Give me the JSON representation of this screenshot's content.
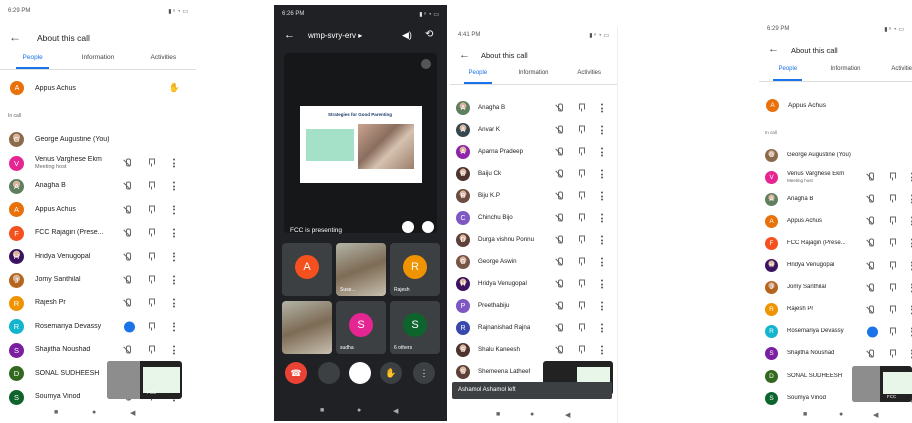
{
  "p1": {
    "status": "6:29 PM",
    "status_r": "▮ ⁿ ◔ ▭",
    "title": "About this call",
    "tabs": [
      "People",
      "Information",
      "Activities"
    ],
    "host": {
      "name": "Appus Achus",
      "letter": "A",
      "color": "#e8710a"
    },
    "section": "In call",
    "rows": [
      {
        "n": "George Augustine (You)",
        "l": "G",
        "c": "#8b6b4a",
        "img": true
      },
      {
        "n": "Venus Varghese Ekm",
        "s": "Meeting host",
        "l": "V",
        "c": "#e52592"
      },
      {
        "n": "Anagha B",
        "l": "A",
        "c": "#5f7f5f",
        "img": true
      },
      {
        "n": "Appus Achus",
        "l": "A",
        "c": "#e8710a"
      },
      {
        "n": "FCC Rajagiri (Prese...",
        "l": "F",
        "c": "#f4511e",
        "blue": true
      },
      {
        "n": "Hridya Venugopal",
        "l": "H",
        "c": "#3c1361",
        "img": true
      },
      {
        "n": "Jomy Santhilal",
        "l": "J",
        "c": "#b5651d",
        "img": true
      },
      {
        "n": "Rajesh Pr",
        "l": "R",
        "c": "#f09300"
      },
      {
        "n": "Rosemariya Devassy",
        "l": "R",
        "c": "#12b5cb",
        "talk": true
      },
      {
        "n": "Shajitha Noushad",
        "l": "S",
        "c": "#7b1fa2"
      },
      {
        "n": "SONAL SUDHEESH",
        "l": "D",
        "c": "#33691e"
      },
      {
        "n": "Soumya Vinod",
        "l": "S",
        "c": "#0d652d"
      }
    ],
    "pip": "FCC"
  },
  "p2": {
    "status": "6:26 PM",
    "status_r": "▮ ⁿ ◔ ▭",
    "code": "wmp-svry-erv ▸",
    "slide": "Strategies for Good Parenting",
    "presenting": "FCC is presenting",
    "tiles": [
      {
        "n": "",
        "l": "A",
        "c": "#f4511e"
      },
      {
        "n": "Suse...",
        "img": true
      },
      {
        "n": "Rajesh",
        "l": "R",
        "c": "#f09300"
      },
      {
        "n": "",
        "img": true
      },
      {
        "n": "sudha",
        "l": "S",
        "c": "#e52592"
      },
      {
        "n": "6 others",
        "l": "S",
        "c": "#0d652d",
        "s2": "S"
      }
    ]
  },
  "p3": {
    "status": "4:41 PM",
    "status_r": "▮ ⁿ ◔ ▭",
    "title": "About this call",
    "tabs": [
      "People",
      "Information",
      "Activities"
    ],
    "rows": [
      {
        "n": "Anagha B",
        "l": "A",
        "c": "#5f7f5f",
        "img": true
      },
      {
        "n": "Anvar K",
        "l": "A",
        "c": "#37474f",
        "img": true
      },
      {
        "n": "Aparna Pradeep",
        "l": "A",
        "c": "#8e24aa",
        "img": true
      },
      {
        "n": "Baiju Ck",
        "l": "B",
        "c": "#4e342e",
        "img": true
      },
      {
        "n": "Biju K.P",
        "l": "B",
        "c": "#6d4c41",
        "img": true
      },
      {
        "n": "Chinchu Bijo",
        "l": "C",
        "c": "#7e57c2"
      },
      {
        "n": "Durga vishnu Ponnu",
        "l": "D",
        "c": "#5d4037",
        "img": true
      },
      {
        "n": "George Aswin",
        "l": "G",
        "c": "#795548",
        "img": true
      },
      {
        "n": "Hridya Venugopal",
        "l": "H",
        "c": "#3c1361",
        "img": true
      },
      {
        "n": "Preethabiju",
        "l": "P",
        "c": "#7e57c2"
      },
      {
        "n": "Rajnanishad Rajna",
        "l": "R",
        "c": "#3949ab"
      },
      {
        "n": "Shalu Kaneesh",
        "l": "S",
        "c": "#4e342e",
        "img": true
      },
      {
        "n": "Shemeena Latheef",
        "l": "S",
        "c": "#5d4037",
        "img": true
      }
    ],
    "toast": "Ashamol Ashamol left"
  },
  "p4": {
    "status": "6:29 PM",
    "status_r": "▮ ⁿ ◔ ▭",
    "title": "About this call",
    "tabs": [
      "People",
      "Information",
      "Activities"
    ],
    "host": {
      "name": "Appus Achus",
      "letter": "A",
      "color": "#e8710a"
    },
    "section": "In call",
    "rows": [
      {
        "n": "George Augustine (You)",
        "l": "G",
        "c": "#8b6b4a",
        "img": true
      },
      {
        "n": "Venus Varghese Ekm",
        "s": "Meeting host",
        "l": "V",
        "c": "#e52592"
      },
      {
        "n": "Anagha B",
        "l": "A",
        "c": "#5f7f5f",
        "img": true
      },
      {
        "n": "Appus Achus",
        "l": "A",
        "c": "#e8710a"
      },
      {
        "n": "FCC Rajagiri (Prese...",
        "l": "F",
        "c": "#f4511e",
        "blue": true
      },
      {
        "n": "Hridya Venugopal",
        "l": "H",
        "c": "#3c1361",
        "img": true
      },
      {
        "n": "Jomy Santhilal",
        "l": "J",
        "c": "#b5651d",
        "img": true
      },
      {
        "n": "Rajesh Pr",
        "l": "R",
        "c": "#f09300"
      },
      {
        "n": "Rosemariya Devassy",
        "l": "R",
        "c": "#12b5cb",
        "talk": true
      },
      {
        "n": "Shajitha Noushad",
        "l": "S",
        "c": "#7b1fa2"
      },
      {
        "n": "SONAL SUDHEESH",
        "l": "D",
        "c": "#33691e"
      },
      {
        "n": "Soumya Vinod",
        "l": "S",
        "c": "#0d652d"
      }
    ],
    "pip": "FCC"
  }
}
